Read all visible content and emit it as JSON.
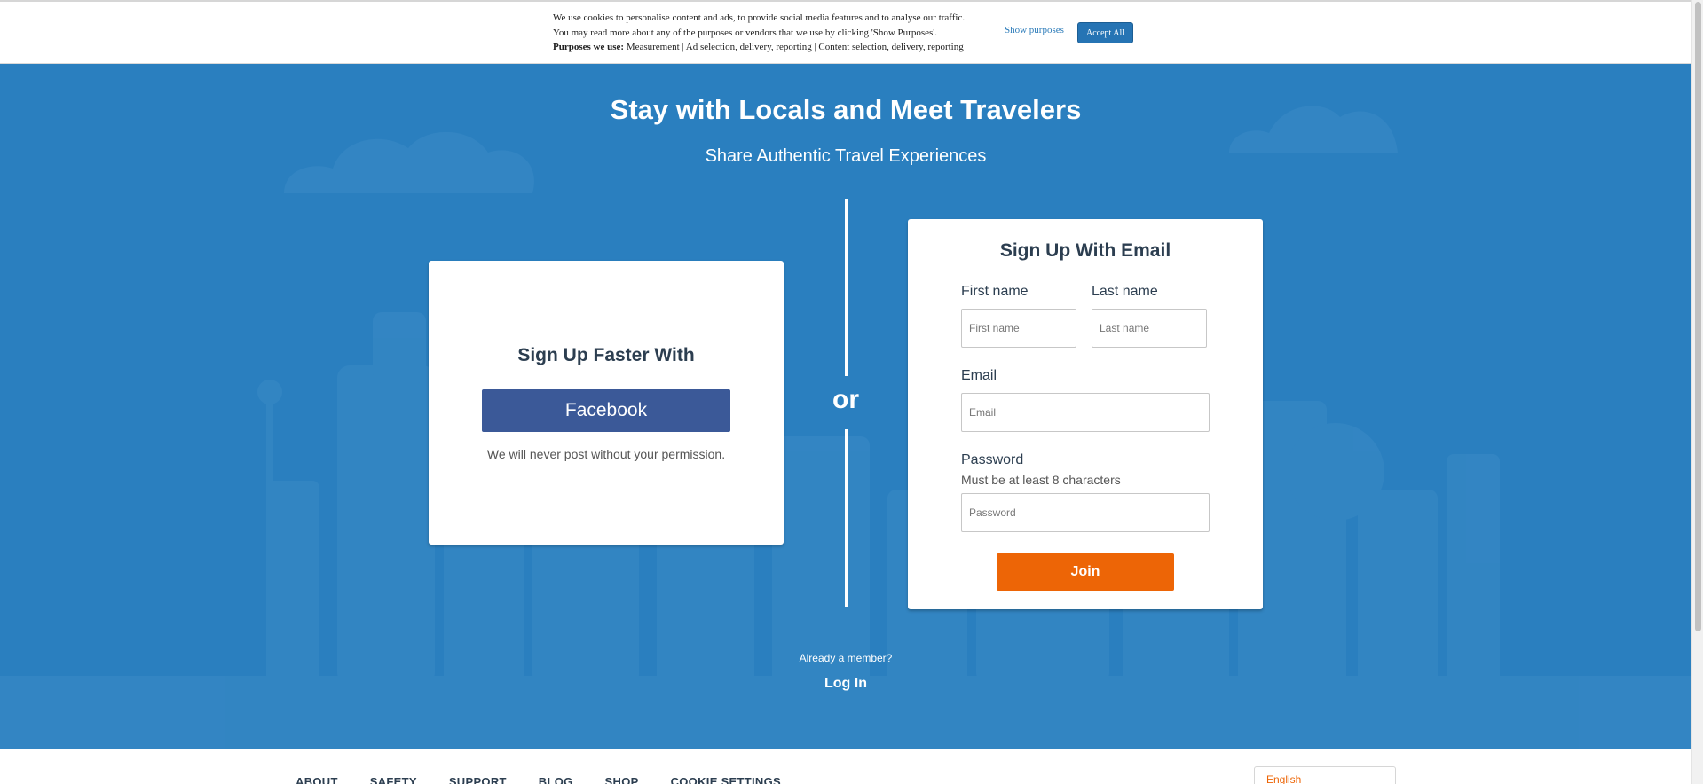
{
  "cookie": {
    "line1": "We use cookies to personalise content and ads, to provide social media features and to analyse our traffic.",
    "line2": "You may read more about any of the purposes or vendors that we use by clicking 'Show Purposes'.",
    "purposes_label": "Purposes we use:",
    "purposes_list": " Measurement | Ad selection, delivery, reporting | Content selection, delivery, reporting",
    "show_purposes": "Show purposes",
    "accept_all": "Accept All"
  },
  "hero": {
    "title": "Stay with Locals and Meet Travelers",
    "subtitle": "Share Authentic Travel Experiences",
    "background_color": "#2a7fbf"
  },
  "social": {
    "heading": "Sign Up Faster With",
    "facebook_label": "Facebook",
    "facebook_color": "#3b5998",
    "disclaimer": "We will never post without your permission."
  },
  "or_label": "or",
  "email_form": {
    "heading": "Sign Up With Email",
    "first_name": {
      "label": "First name",
      "placeholder": "First name",
      "value": ""
    },
    "last_name": {
      "label": "Last name",
      "placeholder": "Last name",
      "value": ""
    },
    "email": {
      "label": "Email",
      "placeholder": "Email",
      "value": ""
    },
    "password": {
      "label": "Password",
      "hint": "Must be at least 8 characters",
      "placeholder": "Password",
      "value": ""
    },
    "join_label": "Join",
    "join_color": "#ed6506"
  },
  "login_prompt": {
    "already": "Already a member?",
    "login": "Log In"
  },
  "footer": {
    "nav": [
      "ABOUT",
      "SAFETY",
      "SUPPORT",
      "BLOG",
      "SHOP",
      "COOKIE SETTINGS"
    ],
    "language": "English"
  }
}
